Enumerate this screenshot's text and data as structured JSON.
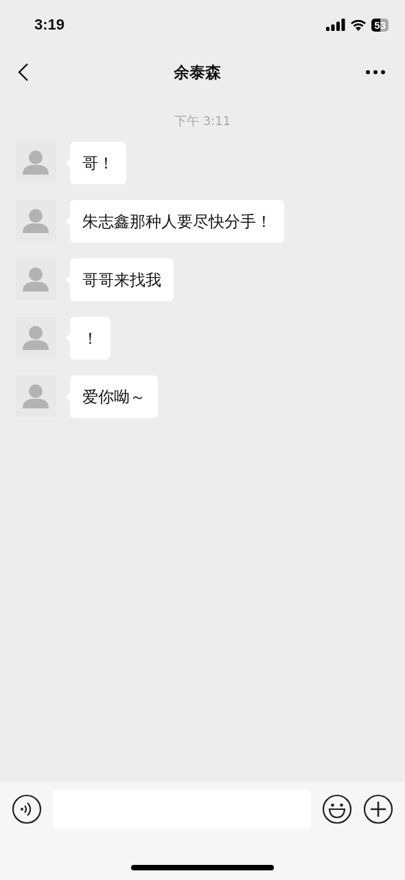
{
  "status_bar": {
    "time": "3:19",
    "battery": "53"
  },
  "nav": {
    "title": "余泰森"
  },
  "timestamp": "下午 3:11",
  "messages": [
    {
      "text": "哥！"
    },
    {
      "text": "朱志鑫那种人要尽快分手！"
    },
    {
      "text": "哥哥来找我"
    },
    {
      "text": "！"
    },
    {
      "text": "爱你呦～"
    }
  ]
}
